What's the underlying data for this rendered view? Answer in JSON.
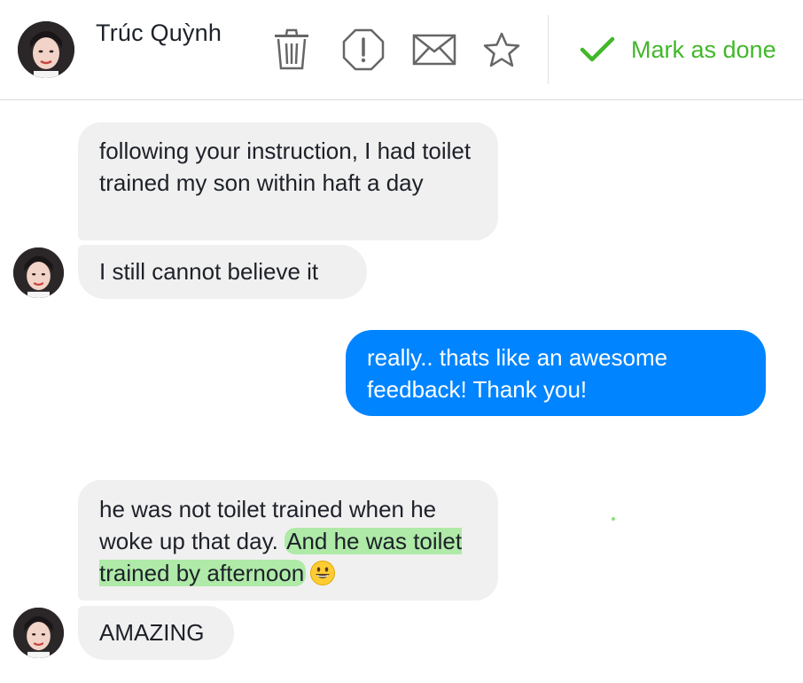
{
  "header": {
    "contact_name": "Trúc Quỳnh",
    "mark_done_label": "Mark as done",
    "accent_color": "#42b72a",
    "icons": [
      "trash-icon",
      "report-icon",
      "mail-icon",
      "star-icon",
      "check-icon"
    ]
  },
  "messages": {
    "m1": "following your instruction, I had toilet trained my son within haft a day",
    "m2": "I still cannot believe it",
    "m3": "really.. thats like an awesome feedback! Thank you!",
    "m4_plain": "he was not toilet trained when he woke up that day.",
    "m4_highlight": "And he was toilet trained by afternoon",
    "m5": "AMAZING"
  },
  "colors": {
    "incoming_bubble": "#f1f0f0",
    "outgoing_bubble": "#0084ff",
    "highlight": "#9be690"
  }
}
